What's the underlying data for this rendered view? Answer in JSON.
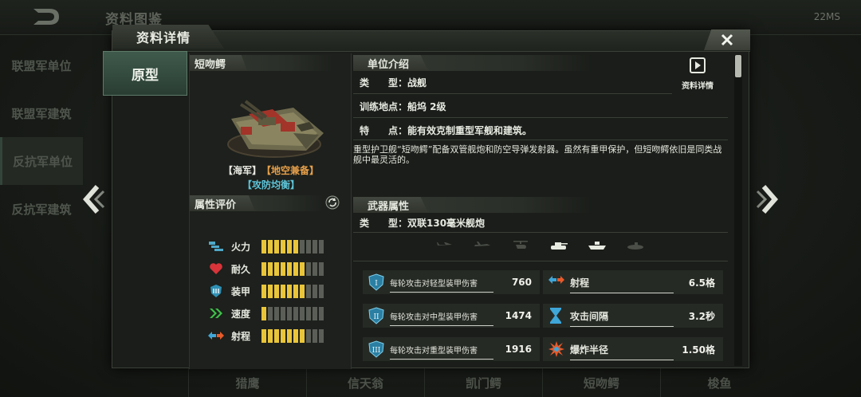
{
  "background": {
    "title": "资料图鉴",
    "net_status": "22MS",
    "left_nav": [
      "联盟军单位",
      "联盟军建筑",
      "反抗军单位",
      "反抗军建筑"
    ],
    "bottom_tabs": [
      "猎鹰",
      "信天翁",
      "凯门鳄",
      "短吻鳄",
      "梭鱼"
    ]
  },
  "dialog": {
    "title": "资料详情",
    "side_tab": "原型",
    "unit": {
      "name": "短吻鳄",
      "tag_faction": "【海军】",
      "tag_role": "【地空兼备】",
      "tag_balance": "【攻防均衡】"
    },
    "attributes": {
      "header": "属性评价",
      "items": [
        {
          "label": "火力",
          "value": 6,
          "max": 10,
          "icon": "firepower-icon"
        },
        {
          "label": "耐久",
          "value": 7,
          "max": 10,
          "icon": "heart-icon"
        },
        {
          "label": "装甲",
          "value": 7,
          "max": 10,
          "icon": "armor-icon"
        },
        {
          "label": "速度",
          "value": 1,
          "max": 10,
          "icon": "speed-icon"
        },
        {
          "label": "射程",
          "value": 7,
          "max": 10,
          "icon": "range-icon"
        }
      ]
    },
    "intro": {
      "header": "单位介绍",
      "type_line": "类　　型：战舰",
      "training_line": "训练地点：船坞 2级",
      "feature_line": "特　　点：能有效克制重型军舰和建筑。",
      "description": "重型护卫舰“短吻鳄”配备双管舰炮和防空导弹发射器。虽然有重甲保护，但短吻鳄依旧是同类战舰中最灵活的。",
      "detail_button": "资料详情"
    },
    "weapon": {
      "header": "武器属性",
      "type_line": "类　　型：双联130毫米舰炮",
      "targets": [
        {
          "name": "fighter-jet-icon",
          "active": false
        },
        {
          "name": "plane-icon",
          "active": false
        },
        {
          "name": "helicopter-icon",
          "active": false
        },
        {
          "name": "tank-icon",
          "active": true
        },
        {
          "name": "ship-icon",
          "active": true
        },
        {
          "name": "submarine-icon",
          "active": false
        }
      ],
      "stats_left": [
        {
          "label": "每轮攻击对轻型装甲伤害",
          "value": "760",
          "icon": "light-armor-icon",
          "roman": "I"
        },
        {
          "label": "每轮攻击对中型装甲伤害",
          "value": "1474",
          "icon": "medium-armor-icon",
          "roman": "II"
        },
        {
          "label": "每轮攻击对重型装甲伤害",
          "value": "1916",
          "icon": "heavy-armor-icon",
          "roman": "III"
        }
      ],
      "stats_right": [
        {
          "label": "射程",
          "value": "6.5格",
          "icon": "range-icon"
        },
        {
          "label": "攻击间隔",
          "value": "3.2秒",
          "icon": "hourglass-icon"
        },
        {
          "label": "爆炸半径",
          "value": "1.50格",
          "icon": "explosion-icon"
        }
      ]
    }
  },
  "colors": {
    "bar_on": "#e9c53a",
    "bar_off": "#5a5e57",
    "accent_teal": "#5ec4d8",
    "accent_orange": "#e8a04a"
  }
}
